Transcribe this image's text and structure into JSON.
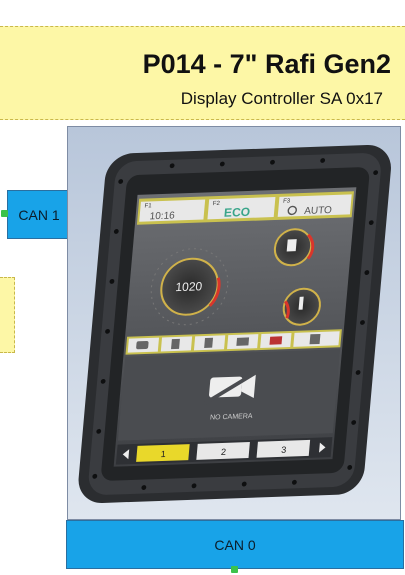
{
  "header": {
    "title": "P014 - 7\" Rafi Gen2",
    "subtitle": "Display Controller SA 0x17",
    "background": "#fdf7a6"
  },
  "connectors": {
    "can1_label": "CAN 1",
    "can0_label": "CAN 0",
    "color": "#18a3e8"
  },
  "device": {
    "f1_label": "F1",
    "f2_label": "F2",
    "f3_label": "F3",
    "clock": "10:16",
    "mode": "ECO",
    "auto": "AUTO",
    "rpm": "1020",
    "camera_label": "NO CAMERA",
    "bottom_tabs": [
      "1",
      "2",
      "3"
    ]
  }
}
